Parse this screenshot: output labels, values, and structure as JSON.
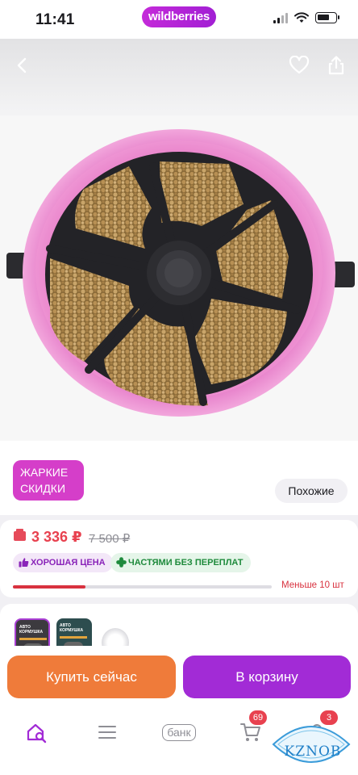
{
  "status_bar": {
    "time": "11:41",
    "brand": "wildberries"
  },
  "icons": {
    "back": "back-arrow-icon",
    "favorite": "heart-icon",
    "share": "share-icon"
  },
  "promo": {
    "badge_line1": "ЖАРКИЕ",
    "badge_line2": "СКИДКИ",
    "similar_label": "Похожие"
  },
  "price": {
    "current": "3 336 ₽",
    "old": "7 500 ₽",
    "chip_good": "ХОРОШАЯ ЦЕНА",
    "chip_installments": "ЧАСТЯМИ БЕЗ ПЕРЕПЛАТ",
    "stock_label": "Меньше 10 шт",
    "stock_fraction": 0.28
  },
  "variants": [
    {
      "label_line1": "АВТО",
      "label_line2": "КОРМУШКА"
    },
    {
      "label_line1": "АВТО",
      "label_line2": "КОРМУШКА"
    }
  ],
  "actions": {
    "buy_now": "Купить сейчас",
    "add_to_cart": "В корзину"
  },
  "tab_bar": {
    "bank_label": "банк",
    "cart_badge": "69",
    "profile_badge": "3"
  },
  "watermark": {
    "text": "KZNOB"
  },
  "colors": {
    "brand": "#a21fd4",
    "price_red": "#e8414f",
    "buy_orange": "#ef7b3a",
    "cart_purple": "#a22bd6",
    "hot_badge": "#d53ec9"
  }
}
